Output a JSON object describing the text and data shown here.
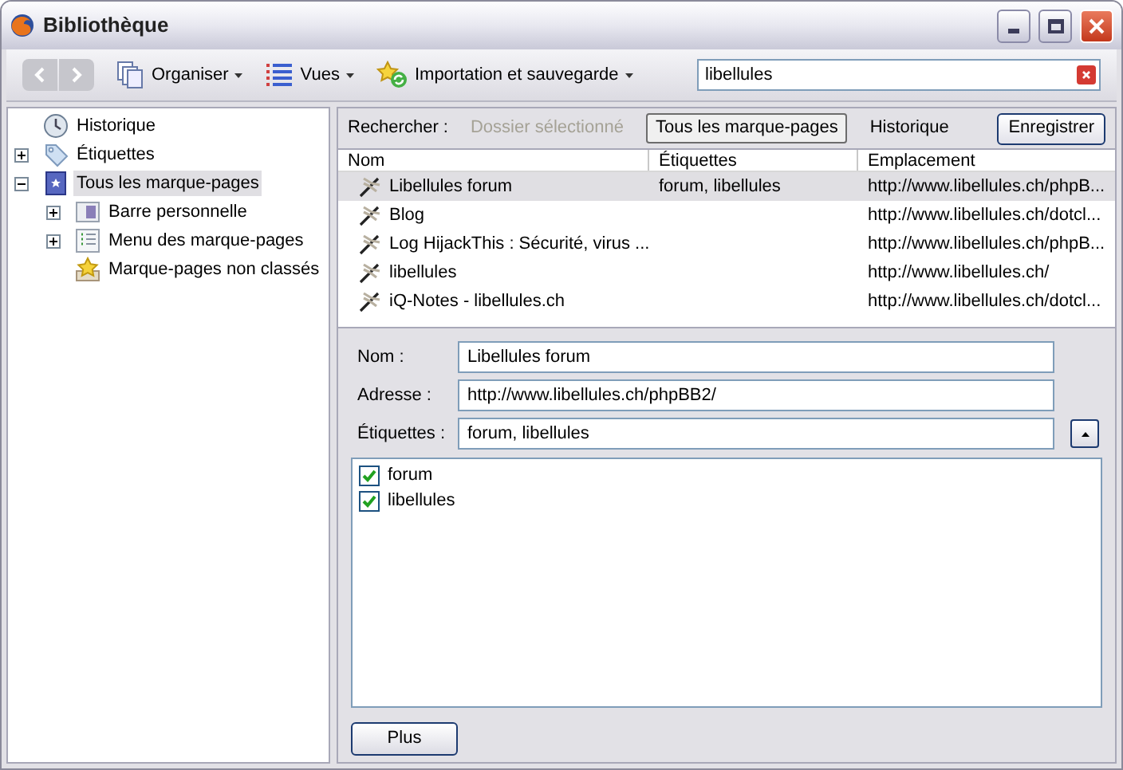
{
  "window": {
    "title": "Bibliothèque"
  },
  "toolbar": {
    "menus": [
      {
        "label": "Organiser",
        "kind": "organize"
      },
      {
        "label": "Vues",
        "kind": "views"
      },
      {
        "label": "Importation et sauvegarde",
        "kind": "import"
      }
    ],
    "search": {
      "value": "libellules"
    }
  },
  "sidebar": {
    "items": [
      {
        "label": "Historique",
        "kind": "history",
        "selected": false
      },
      {
        "label": "Étiquettes",
        "kind": "tags",
        "expanded": false,
        "selected": false
      },
      {
        "label": "Tous les marque-pages",
        "kind": "all",
        "expanded": true,
        "selected": true,
        "children": [
          {
            "label": "Barre personnelle",
            "kind": "bar",
            "expanded": false,
            "selected": false
          },
          {
            "label": "Menu des marque-pages",
            "kind": "menu",
            "expanded": false,
            "selected": false
          },
          {
            "label": "Marque-pages non classés",
            "kind": "unsorted",
            "selected": false
          }
        ]
      }
    ]
  },
  "scope_bar": {
    "label": "Rechercher :",
    "options": [
      {
        "label": "Dossier sélectionné",
        "disabled": true,
        "selected": false
      },
      {
        "label": "Tous les marque-pages",
        "disabled": false,
        "selected": true
      },
      {
        "label": "Historique",
        "disabled": false,
        "selected": false
      }
    ],
    "save_button": "Enregistrer"
  },
  "table": {
    "columns": [
      "Nom",
      "Étiquettes",
      "Emplacement"
    ],
    "rows": [
      {
        "name": "Libellules forum",
        "tags": "forum, libellules",
        "location": "http://www.libellules.ch/phpB...",
        "selected": true
      },
      {
        "name": "Blog",
        "location": "http://www.libellules.ch/dotcl...",
        "selected": false
      },
      {
        "name": "Log HijackThis : Sécurité, virus ...",
        "location": "http://www.libellules.ch/phpB...",
        "selected": false
      },
      {
        "name": "libellules",
        "location": "http://www.libellules.ch/",
        "selected": false
      },
      {
        "name": "iQ-Notes - libellules.ch",
        "location": "http://www.libellules.ch/dotcl...",
        "selected": false
      }
    ]
  },
  "details": {
    "fields": [
      {
        "label": "Nom :",
        "value": "Libellules forum"
      },
      {
        "label": "Adresse :",
        "value": "http://www.libellules.ch/phpBB2/"
      },
      {
        "label": "Étiquettes :",
        "value": "forum, libellules"
      }
    ],
    "tag_list": [
      {
        "label": "forum",
        "checked": true
      },
      {
        "label": "libellules",
        "checked": true
      }
    ],
    "more_button": "Plus"
  }
}
